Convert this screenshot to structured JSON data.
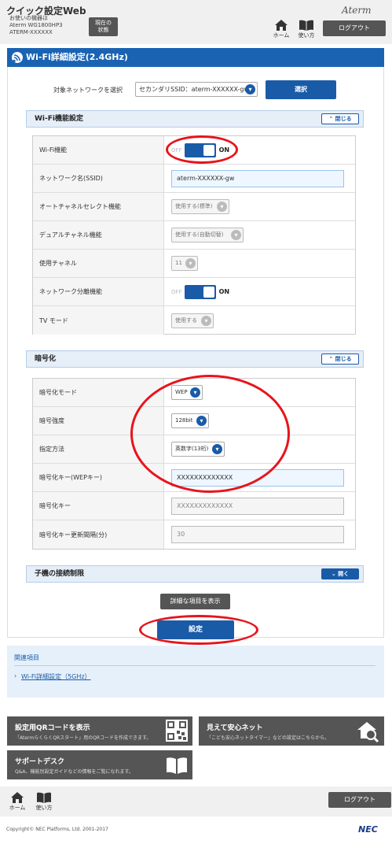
{
  "header": {
    "app_title": "クイック設定Web",
    "device_line1": "お使いの機器は",
    "device_line2": "Aterm WG1800HP3",
    "device_line3": "ATERM-XXXXXX",
    "status_button_line1": "現在の",
    "status_button_line2": "状態",
    "home_label": "ホーム",
    "manual_label": "使い方",
    "brand": "Aterm",
    "logout_label": "ログアウト"
  },
  "page": {
    "title": "Wi-Fi詳細設定(2.4GHz)",
    "target_network_label": "対象ネットワークを選択",
    "target_network_value": "セカンダリSSID：aterm-XXXXXX-gw",
    "select_button": "選択"
  },
  "wifi_section": {
    "title": "Wi-Fi機能設定",
    "collapse_label": "閉じる",
    "rows": [
      {
        "label": "Wi-Fi機能",
        "off": "OFF",
        "on": "ON"
      },
      {
        "label": "ネットワーク名(SSID)",
        "value": "aterm-XXXXXX-gw"
      },
      {
        "label": "オートチャネルセレクト機能",
        "value": "使用する(標準)"
      },
      {
        "label": "デュアルチャネル機能",
        "value": "使用する(自動切替)"
      },
      {
        "label": "使用チャネル",
        "value": "11"
      },
      {
        "label": "ネットワーク分離機能",
        "off": "OFF",
        "on": "ON"
      },
      {
        "label": "TV モード",
        "value": "使用する"
      }
    ]
  },
  "encryption_section": {
    "title": "暗号化",
    "collapse_label": "閉じる",
    "rows": [
      {
        "label": "暗号化モード",
        "value": "WEP"
      },
      {
        "label": "暗号強度",
        "value": "128bit"
      },
      {
        "label": "指定方法",
        "value": "英数字(13桁)"
      },
      {
        "label": "暗号化キー(WEPキー)",
        "value": "XXXXXXXXXXXXX"
      },
      {
        "label": "暗号化キー",
        "value": "XXXXXXXXXXXXX"
      },
      {
        "label": "暗号化キー更新間隔(分)",
        "value": "30"
      }
    ]
  },
  "child_section": {
    "title": "子機の接続制限",
    "expand_label": "開く"
  },
  "actions": {
    "detail_button": "詳細な項目を表示",
    "apply_button": "設定"
  },
  "related": {
    "title": "関連項目",
    "link": "Wi-Fi詳細設定（5GHz）"
  },
  "cards": {
    "qr_title": "設定用QRコードを表示",
    "qr_sub": "「AtermらくらくQRスタート」用のQRコードを作成できます。",
    "safe_title": "見えて安心ネット",
    "safe_sub": "「こども安心ネットタイマー」などの設定はこちらから。",
    "support_title": "サポートデスク",
    "support_sub": "Q&A、機能別設定ガイドなどの情報をご覧になれます。"
  },
  "footer": {
    "home_label": "ホーム",
    "manual_label": "使い方",
    "logout_label": "ログアウト",
    "copyright": "Copyright© NEC Platforms, Ltd. 2001-2017",
    "nec": "NEC"
  },
  "colors": {
    "accent": "#1a5ba8",
    "header_bar": "#1a63b3",
    "highlight_ring": "#e8141b",
    "dark_button": "#555555"
  }
}
